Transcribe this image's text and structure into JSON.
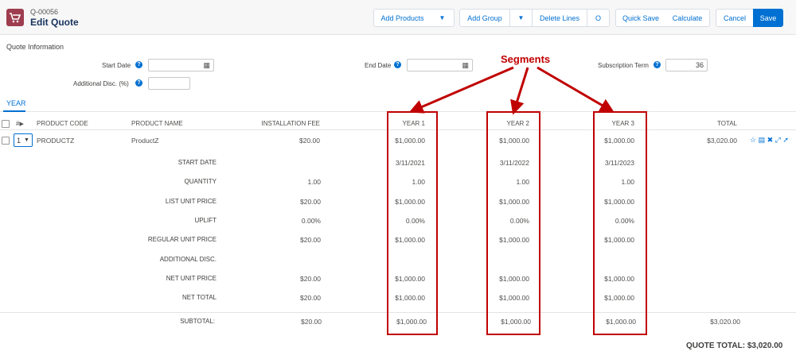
{
  "header": {
    "quote_number": "Q-00056",
    "title": "Edit Quote",
    "buttons": {
      "add_products": "Add Products",
      "add_group": "Add Group",
      "delete_lines": "Delete Lines",
      "circle": "O",
      "quick_save": "Quick Save",
      "calculate": "Calculate",
      "cancel": "Cancel",
      "save": "Save"
    },
    "dropdown_glyph": "▼"
  },
  "quote_info": {
    "title": "Quote Information",
    "start_date": {
      "label": "Start Date",
      "value": ""
    },
    "end_date": {
      "label": "End Date",
      "value": ""
    },
    "subscription_term": {
      "label": "Subscription Term",
      "value": "36"
    },
    "additional_disc": {
      "label": "Additional Disc. (%)",
      "value": ""
    },
    "help_glyph": "?",
    "calendar_glyph": "▦"
  },
  "tabs": {
    "active": "YEAR"
  },
  "table": {
    "headers": {
      "hash": "#",
      "product_code": "PRODUCT CODE",
      "product_name": "PRODUCT NAME",
      "installation_fee": "INSTALLATION FEE",
      "year1": "YEAR 1",
      "year2": "YEAR 2",
      "year3": "YEAR 3",
      "total": "TOTAL"
    },
    "line": {
      "number": "1",
      "product_code": "PRODUCTZ",
      "product_name": "ProductZ",
      "installation_fee": "$20.00",
      "year1": "$1,000.00",
      "year2": "$1,000.00",
      "year3": "$1,000.00",
      "total": "$3,020.00",
      "icons": "☆ ▤ ✖ ⤢ ➚"
    },
    "detail_rows": [
      {
        "label": "START DATE",
        "fee": "",
        "y1": "3/11/2021",
        "y2": "3/11/2022",
        "y3": "3/11/2023"
      },
      {
        "label": "QUANTITY",
        "fee": "1.00",
        "y1": "1.00",
        "y2": "1.00",
        "y3": "1.00"
      },
      {
        "label": "LIST UNIT PRICE",
        "fee": "$20.00",
        "y1": "$1,000.00",
        "y2": "$1,000.00",
        "y3": "$1,000.00"
      },
      {
        "label": "UPLIFT",
        "fee": "0.00%",
        "y1": "0.00%",
        "y2": "0.00%",
        "y3": "0.00%"
      },
      {
        "label": "REGULAR UNIT PRICE",
        "fee": "$20.00",
        "y1": "$1,000.00",
        "y2": "$1,000.00",
        "y3": "$1,000.00"
      },
      {
        "label": "ADDITIONAL DISC.",
        "fee": "",
        "y1": "",
        "y2": "",
        "y3": ""
      },
      {
        "label": "NET UNIT PRICE",
        "fee": "$20.00",
        "y1": "$1,000.00",
        "y2": "$1,000.00",
        "y3": "$1,000.00"
      },
      {
        "label": "NET TOTAL",
        "fee": "$20.00",
        "y1": "$1,000.00",
        "y2": "$1,000.00",
        "y3": "$1,000.00"
      }
    ],
    "subtotal": {
      "label": "SUBTOTAL:",
      "fee": "$20.00",
      "y1": "$1,000.00",
      "y2": "$1,000.00",
      "y3": "$1,000.00",
      "total": "$3,020.00"
    },
    "quote_total": "QUOTE TOTAL: $3,020.00"
  },
  "annotation": {
    "label": "Segments",
    "color": "#c00000"
  }
}
